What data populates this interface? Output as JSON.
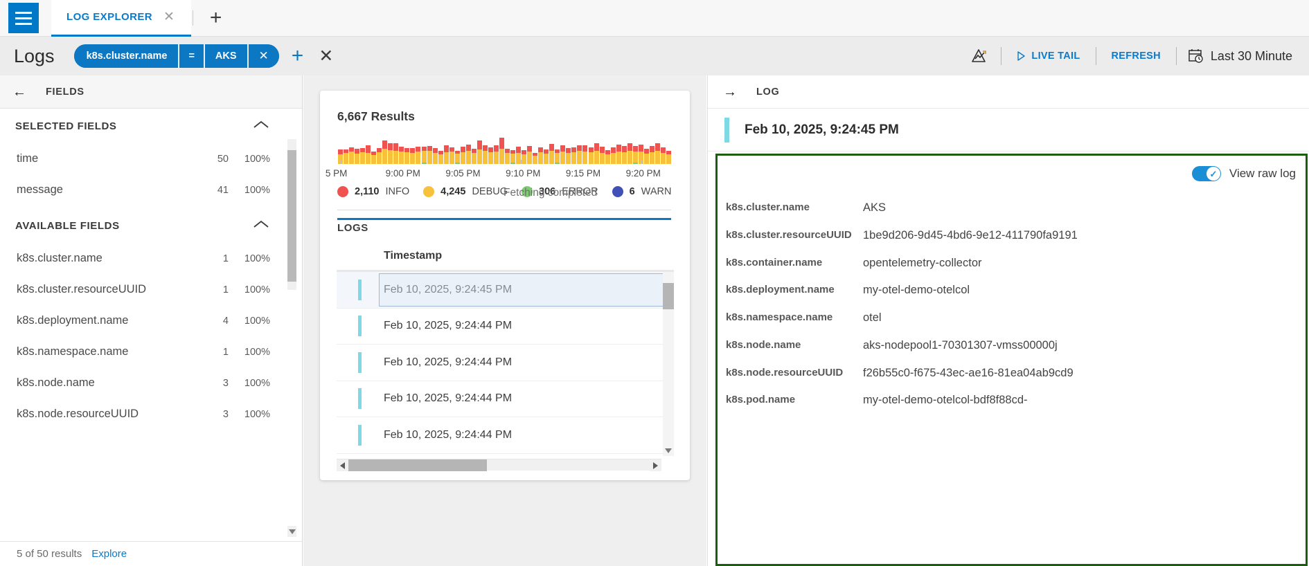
{
  "tabbar": {
    "tab_label": "LOG EXPLORER",
    "close_icon": "close-icon",
    "add_icon": "plus-icon"
  },
  "querybar": {
    "title": "Logs",
    "filter": {
      "key": "k8s.cluster.name",
      "operator": "=",
      "value": "AKS",
      "remove": "✕"
    },
    "add_filter": "+",
    "clear_all": "✕",
    "live_tail": "LIVE TAIL",
    "refresh": "REFRESH",
    "time_range": "Last 30 Minute"
  },
  "sidebar": {
    "header": "FIELDS",
    "selected_fields_title": "SELECTED FIELDS",
    "available_fields_title": "AVAILABLE FIELDS",
    "selected_fields": [
      {
        "name": "time",
        "count": "50",
        "pct": "100%"
      },
      {
        "name": "message",
        "count": "41",
        "pct": "100%"
      }
    ],
    "available_fields": [
      {
        "name": "k8s.cluster.name",
        "count": "1",
        "pct": "100%"
      },
      {
        "name": "k8s.cluster.resourceUUID",
        "count": "1",
        "pct": "100%"
      },
      {
        "name": "k8s.deployment.name",
        "count": "4",
        "pct": "100%"
      },
      {
        "name": "k8s.namespace.name",
        "count": "1",
        "pct": "100%"
      },
      {
        "name": "k8s.node.name",
        "count": "3",
        "pct": "100%"
      },
      {
        "name": "k8s.node.resourceUUID",
        "count": "3",
        "pct": "100%"
      }
    ],
    "footer": {
      "text": "5 of 50 results",
      "link": "Explore"
    }
  },
  "center": {
    "results_title": "6,667 Results",
    "fetching_status": "Fetching completed",
    "logs_label": "LOGS",
    "timestamp_column": "Timestamp",
    "rows": [
      {
        "timestamp": "Feb 10, 2025, 9:24:45 PM",
        "selected": true
      },
      {
        "timestamp": "Feb 10, 2025, 9:24:44 PM",
        "selected": false
      },
      {
        "timestamp": "Feb 10, 2025, 9:24:44 PM",
        "selected": false
      },
      {
        "timestamp": "Feb 10, 2025, 9:24:44 PM",
        "selected": false
      },
      {
        "timestamp": "Feb 10, 2025, 9:24:44 PM",
        "selected": false
      }
    ]
  },
  "chart_data": {
    "type": "bar",
    "title": "6,667 Results",
    "xlabel": "",
    "ylabel": "",
    "grid": false,
    "stacked": true,
    "legend_position": "below",
    "tick_labels": [
      "5 PM",
      "9:00 PM",
      "9:05 PM",
      "9:10 PM",
      "9:15 PM",
      "9:20 PM"
    ],
    "tick_positions_pct": [
      1,
      19,
      37,
      55,
      73,
      91
    ],
    "legend": [
      {
        "label": "INFO",
        "count": "2,110",
        "color": "#ef5350"
      },
      {
        "label": "DEBUG",
        "count": "4,245",
        "color": "#f7c13c"
      },
      {
        "label": "ERROR",
        "count": "306",
        "color": "#7dcc72"
      },
      {
        "label": "WARN",
        "count": "6",
        "color": "#3f51b5"
      }
    ],
    "series": [
      {
        "name": "DEBUG",
        "color": "#f7c13c",
        "values": [
          14,
          16,
          18,
          15,
          17,
          16,
          13,
          17,
          22,
          20,
          19,
          18,
          17,
          16,
          18,
          17,
          19,
          16,
          14,
          17,
          18,
          13,
          17,
          19,
          16,
          21,
          19,
          17,
          18,
          22,
          16,
          13,
          16,
          14,
          18,
          12,
          17,
          15,
          19,
          14,
          18,
          16,
          17,
          19,
          18,
          17,
          19,
          16,
          14,
          16,
          18,
          17,
          19,
          16,
          18,
          15,
          17,
          19,
          16,
          14
        ]
      },
      {
        "name": "INFO",
        "color": "#ef5350",
        "values": [
          7,
          5,
          6,
          7,
          6,
          11,
          5,
          6,
          12,
          10,
          11,
          7,
          6,
          7,
          7,
          6,
          7,
          7,
          5,
          10,
          6,
          4,
          8,
          9,
          6,
          13,
          8,
          7,
          9,
          16,
          6,
          5,
          9,
          6,
          8,
          4,
          7,
          6,
          10,
          5,
          9,
          7,
          7,
          8,
          9,
          7,
          11,
          9,
          6,
          8,
          10,
          9,
          11,
          8,
          10,
          7,
          9,
          11,
          8,
          5
        ]
      },
      {
        "name": "ERROR",
        "color": "#7dcc72",
        "values": [
          0,
          0,
          0,
          0,
          0,
          0,
          0,
          0,
          0,
          0,
          0,
          0,
          0,
          0,
          0,
          2,
          0,
          0,
          0,
          0,
          0,
          2,
          0,
          0,
          0,
          0,
          0,
          0,
          0,
          0,
          0,
          2,
          0,
          0,
          0,
          0,
          0,
          0,
          0,
          2,
          0,
          0,
          0,
          0,
          0,
          0,
          0,
          0,
          0,
          0,
          0,
          0,
          0,
          2,
          0,
          0,
          0,
          0,
          0,
          0
        ]
      }
    ]
  },
  "log_panel": {
    "header": "LOG",
    "timestamp": "Feb 10, 2025, 9:24:45 PM",
    "raw_log_toggle_label": "View raw log",
    "raw_log_toggle_on": true,
    "fields": [
      {
        "key": "k8s.cluster.name",
        "value": "AKS"
      },
      {
        "key": "k8s.cluster.resourceUUID",
        "value": "1be9d206-9d45-4bd6-9e12-411790fa9191"
      },
      {
        "key": "k8s.container.name",
        "value": "opentelemetry-collector"
      },
      {
        "key": "k8s.deployment.name",
        "value": "my-otel-demo-otelcol"
      },
      {
        "key": "k8s.namespace.name",
        "value": "otel"
      },
      {
        "key": "k8s.node.name",
        "value": "aks-nodepool1-70301307-vmss00000j"
      },
      {
        "key": "k8s.node.resourceUUID",
        "value": "f26b55c0-f675-43ec-ae16-81ea04ab9cd9"
      },
      {
        "key": "k8s.pod.name",
        "value": "my-otel-demo-otelcol-bdf8f88cd-"
      }
    ]
  },
  "colors": {
    "accent": "#0c78c4",
    "highlight_box": "#1b5e0f",
    "timestamp_bar": "#7fd9e4"
  }
}
